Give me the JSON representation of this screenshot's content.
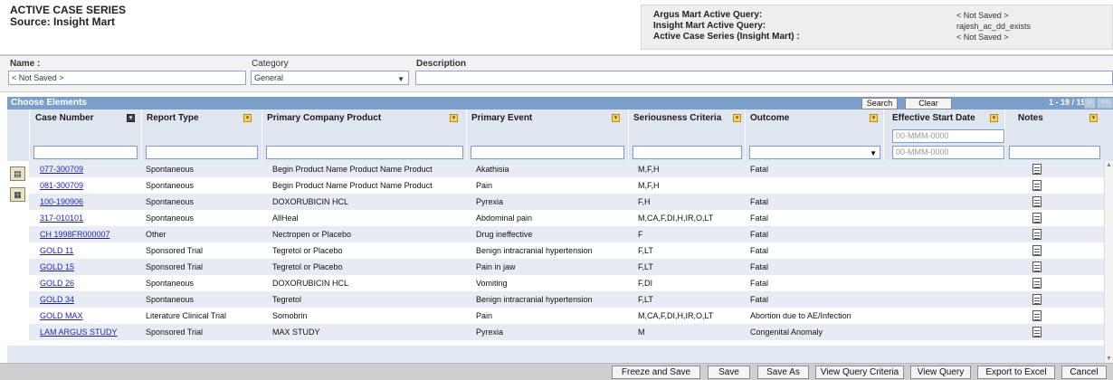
{
  "header": {
    "title_line1": "ACTIVE CASE SERIES",
    "title_line2": "Source: Insight Mart"
  },
  "query_info": {
    "argus_label": "Argus Mart Active Query:",
    "argus_value": "< Not Saved >",
    "insight_label": "Insight Mart Active Query:",
    "insight_value": "rajesh_ac_dd_exists",
    "series_label": "Active Case Series (Insight Mart) :",
    "series_value": "< Not Saved >"
  },
  "form": {
    "name_label": "Name :",
    "name_value": "< Not Saved >",
    "category_label": "Category",
    "category_value": "General",
    "description_label": "Description",
    "description_value": ""
  },
  "grid": {
    "title": "Choose Elements",
    "search_label": "Search",
    "clear_label": "Clear",
    "range_text": "1 - 19 / 19",
    "columns": {
      "case_number": "Case Number",
      "report_type": "Report Type",
      "product": "Primary Company Product",
      "event": "Primary Event",
      "seriousness": "Seriousness Criteria",
      "outcome": "Outcome",
      "start_date": "Effective Start Date",
      "notes": "Notes"
    },
    "date_placeholder_1": "00-MMM-0000",
    "date_placeholder_2": "00-MMM-0000",
    "rows": [
      {
        "case": "077-300709",
        "type": "Spontaneous",
        "product": "Begin Product Name Product Name Product",
        "event": "Akathisia",
        "seriousness": "M,F,H",
        "outcome": "Fatal"
      },
      {
        "case": "081-300709",
        "type": "Spontaneous",
        "product": "Begin Product Name Product Name Product",
        "event": "Pain",
        "seriousness": "M,F,H",
        "outcome": ""
      },
      {
        "case": "100-190906",
        "type": "Spontaneous",
        "product": "DOXORUBICIN HCL",
        "event": "Pyrexia",
        "seriousness": "F,H",
        "outcome": "Fatal"
      },
      {
        "case": "317-010101",
        "type": "Spontaneous",
        "product": "AllHeal",
        "event": "Abdominal pain",
        "seriousness": "M,CA,F,DI,H,IR,O,LT",
        "outcome": "Fatal"
      },
      {
        "case": "CH 1998FR000007",
        "type": "Other",
        "product": "Nectropen or Placebo",
        "event": "Drug ineffective",
        "seriousness": "F",
        "outcome": "Fatal"
      },
      {
        "case": "GOLD 11",
        "type": "Sponsored Trial",
        "product": "Tegretol or Placebo",
        "event": "Benign intracranial hypertension",
        "seriousness": "F,LT",
        "outcome": "Fatal"
      },
      {
        "case": "GOLD 15",
        "type": "Sponsored Trial",
        "product": "Tegretol or Placebo",
        "event": "Pain in jaw",
        "seriousness": "F,LT",
        "outcome": "Fatal"
      },
      {
        "case": "GOLD 26",
        "type": "Spontaneous",
        "product": "DOXORUBICIN HCL",
        "event": "Vomiting",
        "seriousness": "F,DI",
        "outcome": "Fatal"
      },
      {
        "case": "GOLD 34",
        "type": "Spontaneous",
        "product": "Tegretol",
        "event": "Benign intracranial hypertension",
        "seriousness": "F,LT",
        "outcome": "Fatal"
      },
      {
        "case": "GOLD MAX",
        "type": "Literature Clinical Trial",
        "product": "Somobrin",
        "event": "Pain",
        "seriousness": "M,CA,F,DI,H,IR,O,LT",
        "outcome": "Abortion due to AE/Infection"
      },
      {
        "case": "LAM ARGUS STUDY",
        "type": "Sponsored Trial",
        "product": "MAX STUDY",
        "event": "Pyrexia",
        "seriousness": "M",
        "outcome": "Congenital Anomaly"
      }
    ]
  },
  "footer": {
    "freeze_save": "Freeze and Save",
    "save": "Save",
    "save_as": "Save As",
    "view_query_criteria": "View Query Criteria",
    "view_query": "View Query",
    "export_excel": "Export to Excel",
    "cancel": "Cancel"
  },
  "colors": {
    "grid_header_bar": "#7c9fca",
    "row_alt": "#e7ecf4",
    "link": "#1f1fb4"
  },
  "icons": {
    "sort": "sort-icon",
    "notes": "notes-icon",
    "side_add": "add-case-icon",
    "side_view": "view-case-icon"
  }
}
